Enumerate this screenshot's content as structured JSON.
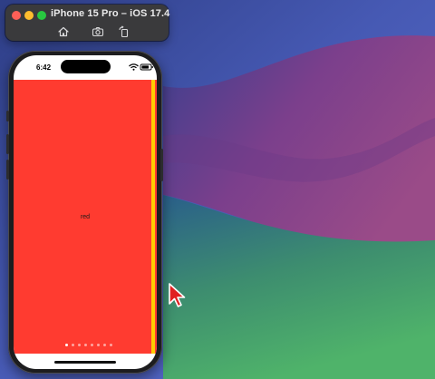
{
  "desktop": {
    "colors": {
      "top": "#4a5fb9",
      "wave": "#7a3d8f",
      "bottom": "#3f9a63"
    }
  },
  "simulator": {
    "title": "iPhone 15 Pro – iOS 17.4",
    "toolbar": {
      "home_icon": "home-icon",
      "screenshot_icon": "camera-icon",
      "rotate_icon": "rotate-icon"
    }
  },
  "device": {
    "status_bar": {
      "time": "6:42",
      "icons": [
        "wifi-icon",
        "battery-icon"
      ]
    },
    "page": {
      "label": "red",
      "background": "#ff3b30",
      "next_page_edge": "#ffcc00",
      "page_count": 8,
      "current_page": 1
    }
  },
  "cursor": {
    "color": "#e02020"
  }
}
